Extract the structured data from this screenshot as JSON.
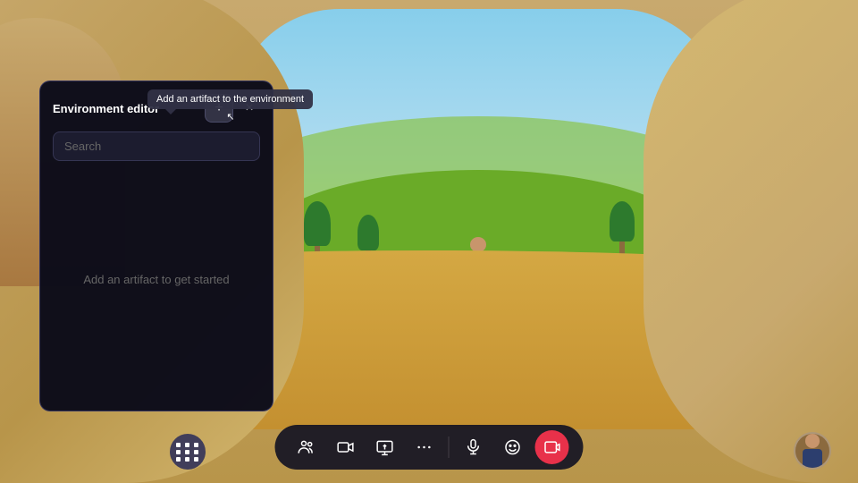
{
  "scene": {
    "background_color": "#c8a96e"
  },
  "tooltip": {
    "text": "Add an artifact to the environment"
  },
  "panel": {
    "title": "Environment editor",
    "search_placeholder": "Search",
    "empty_message": "Add an artifact to get started",
    "add_button_label": "+",
    "close_button_label": "×"
  },
  "toolbar": {
    "buttons": [
      {
        "id": "people",
        "icon": "people",
        "label": "People"
      },
      {
        "id": "video",
        "icon": "video",
        "label": "Video"
      },
      {
        "id": "share",
        "icon": "share",
        "label": "Share"
      },
      {
        "id": "more",
        "icon": "more",
        "label": "More"
      },
      {
        "id": "mic",
        "icon": "mic",
        "label": "Microphone"
      },
      {
        "id": "emoji",
        "icon": "emoji",
        "label": "Emoji"
      },
      {
        "id": "record",
        "icon": "record",
        "label": "Record",
        "active": true
      }
    ]
  }
}
